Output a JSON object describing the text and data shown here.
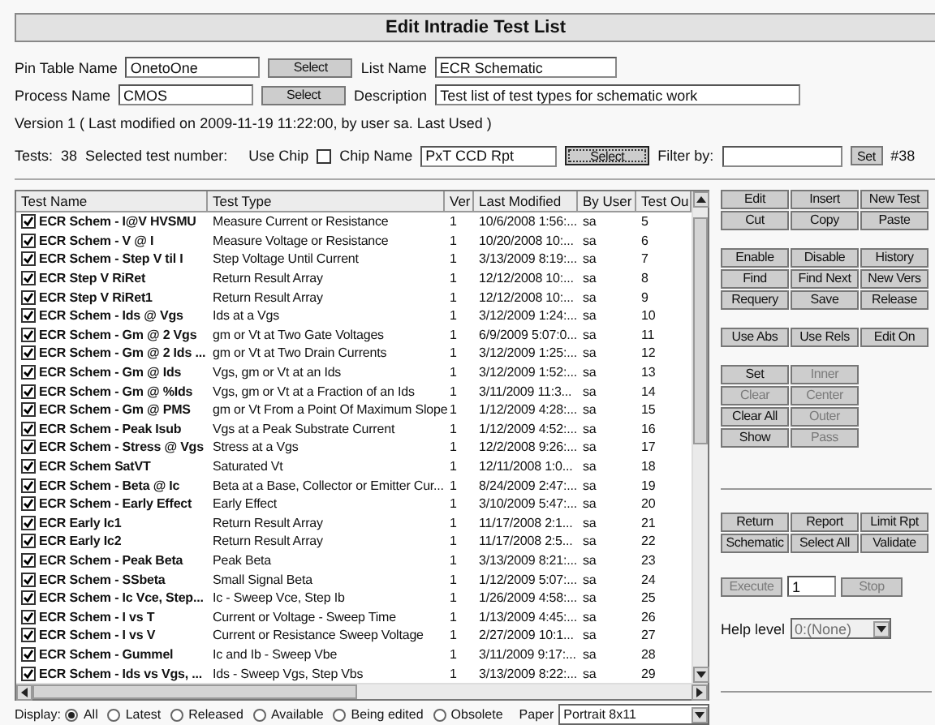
{
  "title": "Edit Intradie Test List",
  "pin_table": {
    "label": "Pin Table Name",
    "value": "OnetoOne",
    "button": "Select"
  },
  "list_name": {
    "label": "List Name",
    "value": "ECR Schematic"
  },
  "process": {
    "label": "Process Name",
    "value": "CMOS",
    "button": "Select"
  },
  "description": {
    "label": "Description",
    "value": "Test list of test types for schematic work"
  },
  "version_line": "Version 1 ( Last modified on 2009-11-19 11:22:00,  by user sa. Last Used  )",
  "tests_bar": {
    "tests_label": "Tests:",
    "tests_count": "38",
    "selected_label": "Selected test number:",
    "use_chip": {
      "label": "Use Chip",
      "checked": false
    },
    "chip_name": {
      "label": "Chip Name",
      "value": "PxT CCD Rpt",
      "button": "Select"
    },
    "filter": {
      "label": "Filter by:",
      "button": "Set"
    },
    "count_tag": "#38"
  },
  "table": {
    "columns": [
      "Test Name",
      "Test Type",
      "Ver",
      "Last Modified",
      "By User",
      "Test Ou"
    ],
    "rows": [
      {
        "checked": true,
        "name": "ECR Schem - I@V HVSMU",
        "type": "Measure Current or Resistance",
        "ver": "1",
        "modified": "10/6/2008 1:56:...",
        "user": "sa",
        "order": "5"
      },
      {
        "checked": true,
        "name": "ECR Schem - V @ I",
        "type": "Measure Voltage or Resistance",
        "ver": "1",
        "modified": "10/20/2008 10:...",
        "user": "sa",
        "order": "6"
      },
      {
        "checked": true,
        "name": "ECR Schem - Step V til I",
        "type": "Step Voltage Until Current",
        "ver": "1",
        "modified": "3/13/2009 8:19:...",
        "user": "sa",
        "order": "7"
      },
      {
        "checked": true,
        "name": "ECR Step V RiRet",
        "type": "Return Result Array",
        "ver": "1",
        "modified": "12/12/2008 10:...",
        "user": "sa",
        "order": "8"
      },
      {
        "checked": true,
        "name": "ECR Step V RiRet1",
        "type": "Return Result Array",
        "ver": "1",
        "modified": "12/12/2008 10:...",
        "user": "sa",
        "order": "9"
      },
      {
        "checked": true,
        "name": "ECR Schem - Ids @ Vgs",
        "type": "Ids at a Vgs",
        "ver": "1",
        "modified": "3/12/2009 1:24:...",
        "user": "sa",
        "order": "10"
      },
      {
        "checked": true,
        "name": "ECR Schem - Gm @ 2 Vgs",
        "type": "gm or Vt at Two Gate Voltages",
        "ver": "1",
        "modified": "6/9/2009 5:07:0...",
        "user": "sa",
        "order": "11"
      },
      {
        "checked": true,
        "name": "ECR Schem - Gm @ 2 Ids ...",
        "type": "gm or Vt at Two Drain Currents",
        "ver": "1",
        "modified": "3/12/2009 1:25:...",
        "user": "sa",
        "order": "12"
      },
      {
        "checked": true,
        "name": "ECR Schem - Gm @ Ids",
        "type": "Vgs, gm or Vt at an Ids",
        "ver": "1",
        "modified": "3/12/2009 1:52:...",
        "user": "sa",
        "order": "13"
      },
      {
        "checked": true,
        "name": "ECR Schem - Gm @ %Ids",
        "type": "Vgs, gm or Vt at a Fraction of an Ids",
        "ver": "1",
        "modified": "3/11/2009 11:3...",
        "user": "sa",
        "order": "14"
      },
      {
        "checked": true,
        "name": "ECR Schem - Gm @ PMS",
        "type": "gm or Vt From a Point Of Maximum Slope",
        "ver": "1",
        "modified": "1/12/2009 4:28:...",
        "user": "sa",
        "order": "15"
      },
      {
        "checked": true,
        "name": "ECR Schem - Peak Isub",
        "type": "Vgs at a Peak Substrate Current",
        "ver": "1",
        "modified": "1/12/2009 4:52:...",
        "user": "sa",
        "order": "16"
      },
      {
        "checked": true,
        "name": "ECR Schem - Stress @ Vgs",
        "type": "Stress at a Vgs",
        "ver": "1",
        "modified": "12/2/2008 9:26:...",
        "user": "sa",
        "order": "17"
      },
      {
        "checked": true,
        "name": "ECR Schem SatVT",
        "type": "Saturated Vt",
        "ver": "1",
        "modified": "12/11/2008 1:0...",
        "user": "sa",
        "order": "18"
      },
      {
        "checked": true,
        "name": "ECR Schem - Beta @ Ic",
        "type": "Beta at a Base, Collector or Emitter Cur...",
        "ver": "1",
        "modified": "8/24/2009 2:47:...",
        "user": "sa",
        "order": "19"
      },
      {
        "checked": true,
        "name": "ECR Schem - Early Effect",
        "type": "Early Effect",
        "ver": "1",
        "modified": "3/10/2009 5:47:...",
        "user": "sa",
        "order": "20"
      },
      {
        "checked": true,
        "name": "ECR Early Ic1",
        "type": "Return Result Array",
        "ver": "1",
        "modified": "11/17/2008 2:1...",
        "user": "sa",
        "order": "21"
      },
      {
        "checked": true,
        "name": "ECR Early Ic2",
        "type": "Return Result Array",
        "ver": "1",
        "modified": "11/17/2008 2:5...",
        "user": "sa",
        "order": "22"
      },
      {
        "checked": true,
        "name": "ECR Schem - Peak Beta",
        "type": "Peak Beta",
        "ver": "1",
        "modified": "3/13/2009 8:21:...",
        "user": "sa",
        "order": "23"
      },
      {
        "checked": true,
        "name": "ECR Schem - SSbeta",
        "type": "Small Signal Beta",
        "ver": "1",
        "modified": "1/12/2009 5:07:...",
        "user": "sa",
        "order": "24"
      },
      {
        "checked": true,
        "name": "ECR Schem - Ic Vce, Step...",
        "type": "Ic - Sweep Vce, Step Ib",
        "ver": "1",
        "modified": "1/26/2009 4:58:...",
        "user": "sa",
        "order": "25"
      },
      {
        "checked": true,
        "name": "ECR Schem - I vs T",
        "type": "Current or Voltage - Sweep Time",
        "ver": "1",
        "modified": "1/13/2009 4:45:...",
        "user": "sa",
        "order": "26"
      },
      {
        "checked": true,
        "name": "ECR Schem - I vs V",
        "type": "Current or Resistance Sweep Voltage",
        "ver": "1",
        "modified": "2/27/2009 10:1...",
        "user": "sa",
        "order": "27"
      },
      {
        "checked": true,
        "name": "ECR Schem - Gummel",
        "type": "Ic and Ib - Sweep Vbe",
        "ver": "1",
        "modified": "3/11/2009 9:17:...",
        "user": "sa",
        "order": "28"
      },
      {
        "checked": true,
        "name": "ECR Schem - Ids vs Vgs, ...",
        "type": "Ids - Sweep Vgs, Step Vbs",
        "ver": "1",
        "modified": "3/13/2009 8:22:...",
        "user": "sa",
        "order": "29"
      }
    ]
  },
  "button_groups": [
    {
      "kind": "grid3",
      "buttons": [
        {
          "label": "Edit",
          "disabled": false
        },
        {
          "label": "Insert",
          "disabled": false
        },
        {
          "label": "New Test",
          "disabled": false
        },
        {
          "label": "Cut",
          "disabled": false
        },
        {
          "label": "Copy",
          "disabled": false
        },
        {
          "label": "Paste",
          "disabled": false
        }
      ]
    },
    {
      "kind": "grid3",
      "buttons": [
        {
          "label": "Enable",
          "disabled": false
        },
        {
          "label": "Disable",
          "disabled": false
        },
        {
          "label": "History",
          "disabled": false
        },
        {
          "label": "Find",
          "disabled": false
        },
        {
          "label": "Find Next",
          "disabled": false
        },
        {
          "label": "New Vers",
          "disabled": false
        },
        {
          "label": "Requery",
          "disabled": false
        },
        {
          "label": "Save",
          "disabled": false
        },
        {
          "label": "Release",
          "disabled": false
        }
      ]
    },
    {
      "kind": "grid3",
      "buttons": [
        {
          "label": "Use Abs",
          "disabled": false
        },
        {
          "label": "Use Rels",
          "disabled": false
        },
        {
          "label": "Edit On",
          "disabled": false
        }
      ]
    },
    {
      "kind": "grid2",
      "buttons": [
        {
          "label": "Set",
          "disabled": false
        },
        {
          "label": "Inner",
          "disabled": true
        },
        {
          "label": "Clear",
          "disabled": true
        },
        {
          "label": "Center",
          "disabled": true
        },
        {
          "label": "Clear All",
          "disabled": false
        },
        {
          "label": "Outer",
          "disabled": true
        },
        {
          "label": "Show",
          "disabled": false
        },
        {
          "label": "Pass",
          "disabled": true
        }
      ]
    }
  ],
  "lower_buttons": [
    {
      "label": "Return",
      "disabled": false
    },
    {
      "label": "Report",
      "disabled": false
    },
    {
      "label": "Limit Rpt",
      "disabled": false
    },
    {
      "label": "Schematic",
      "disabled": false
    },
    {
      "label": "Select All",
      "disabled": false
    },
    {
      "label": "Validate",
      "disabled": false
    }
  ],
  "execute": {
    "button": {
      "label": "Execute",
      "disabled": true
    },
    "value": "1",
    "stop": {
      "label": "Stop",
      "disabled": true
    }
  },
  "help_level": {
    "label": "Help level",
    "value": "0:(None)",
    "disabled": true
  },
  "display": {
    "label": "Display:",
    "options": [
      {
        "label": "All",
        "selected": true
      },
      {
        "label": "Latest",
        "selected": false
      },
      {
        "label": "Released",
        "selected": false
      },
      {
        "label": "Available",
        "selected": false
      },
      {
        "label": "Being edited",
        "selected": false
      },
      {
        "label": "Obsolete",
        "selected": false
      }
    ]
  },
  "paper": {
    "label": "Paper",
    "value": "Portrait 8x11"
  }
}
